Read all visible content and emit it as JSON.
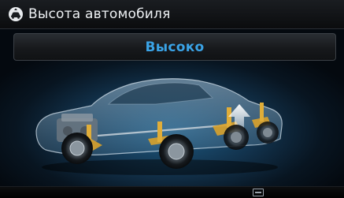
{
  "header": {
    "title": "Высота автомобиля",
    "icon": "car-height-icon"
  },
  "setting": {
    "value": "Высоко"
  },
  "illustration": {
    "subject": "car-xray-suspension-illustration",
    "indicator": "up-arrow-icon"
  },
  "footer": {
    "icon": "media-status-icon"
  },
  "colors": {
    "accent": "#3aa3e6",
    "title_text": "#eef1f4",
    "background": "#12324c",
    "suspension": "#d9a22b"
  }
}
